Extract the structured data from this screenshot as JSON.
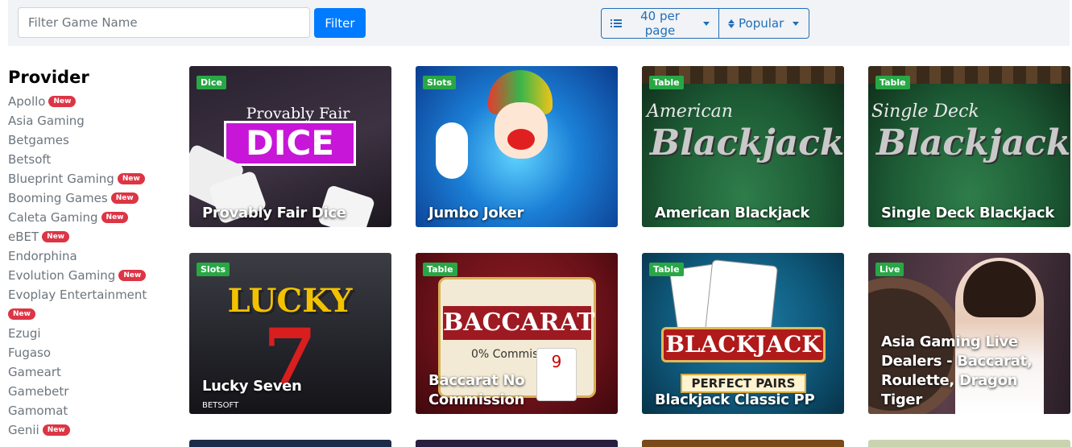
{
  "search": {
    "placeholder": "Filter Game Name",
    "button": "Filter"
  },
  "toolbar": {
    "per_page": "40 per page",
    "sort": "Popular"
  },
  "sidebar": {
    "heading": "Provider",
    "badge": "New",
    "providers": [
      {
        "name": "Apollo",
        "new": true
      },
      {
        "name": "Asia Gaming",
        "new": false
      },
      {
        "name": "Betgames",
        "new": false
      },
      {
        "name": "Betsoft",
        "new": false
      },
      {
        "name": "Blueprint Gaming",
        "new": true
      },
      {
        "name": "Booming Games",
        "new": true
      },
      {
        "name": "Caleta Gaming",
        "new": true
      },
      {
        "name": "eBET",
        "new": true
      },
      {
        "name": "Endorphina",
        "new": false
      },
      {
        "name": "Evolution Gaming",
        "new": true
      },
      {
        "name": "Evoplay Entertainment",
        "new": true
      },
      {
        "name": "Ezugi",
        "new": false
      },
      {
        "name": "Fugaso",
        "new": false
      },
      {
        "name": "Gameart",
        "new": false
      },
      {
        "name": "Gamebetr",
        "new": false
      },
      {
        "name": "Gamomat",
        "new": false
      },
      {
        "name": "Genii",
        "new": true
      }
    ]
  },
  "games": [
    {
      "title": "Provably Fair Dice",
      "category": "Dice",
      "art_top": "Provably Fair",
      "art_main": "DICE"
    },
    {
      "title": "Jumbo Joker",
      "category": "Slots"
    },
    {
      "title": "American Blackjack",
      "category": "Table",
      "art_top": "American",
      "art_main": "Blackjack"
    },
    {
      "title": "Single Deck Blackjack",
      "category": "Table",
      "art_top": "Single Deck",
      "art_main": "Blackjack"
    },
    {
      "title": "Lucky Seven",
      "category": "Slots",
      "provider": "BETSOFT",
      "art_main": "LUCKY"
    },
    {
      "title": "Baccarat No Commission",
      "category": "Table",
      "art_main": "BACCARAT",
      "art_sub": "0% Commission"
    },
    {
      "title": "Blackjack Classic PP",
      "category": "Table",
      "art_main": "BLACKJACK",
      "art_sub": "PERFECT PAIRS"
    },
    {
      "title": "Asia Gaming Live Dealers - Baccarat, Roulette, Dragon Tiger",
      "category": "Live"
    }
  ],
  "colors": {
    "primary": "#007bff",
    "badge": "#dc3545",
    "category": "#28a745"
  }
}
